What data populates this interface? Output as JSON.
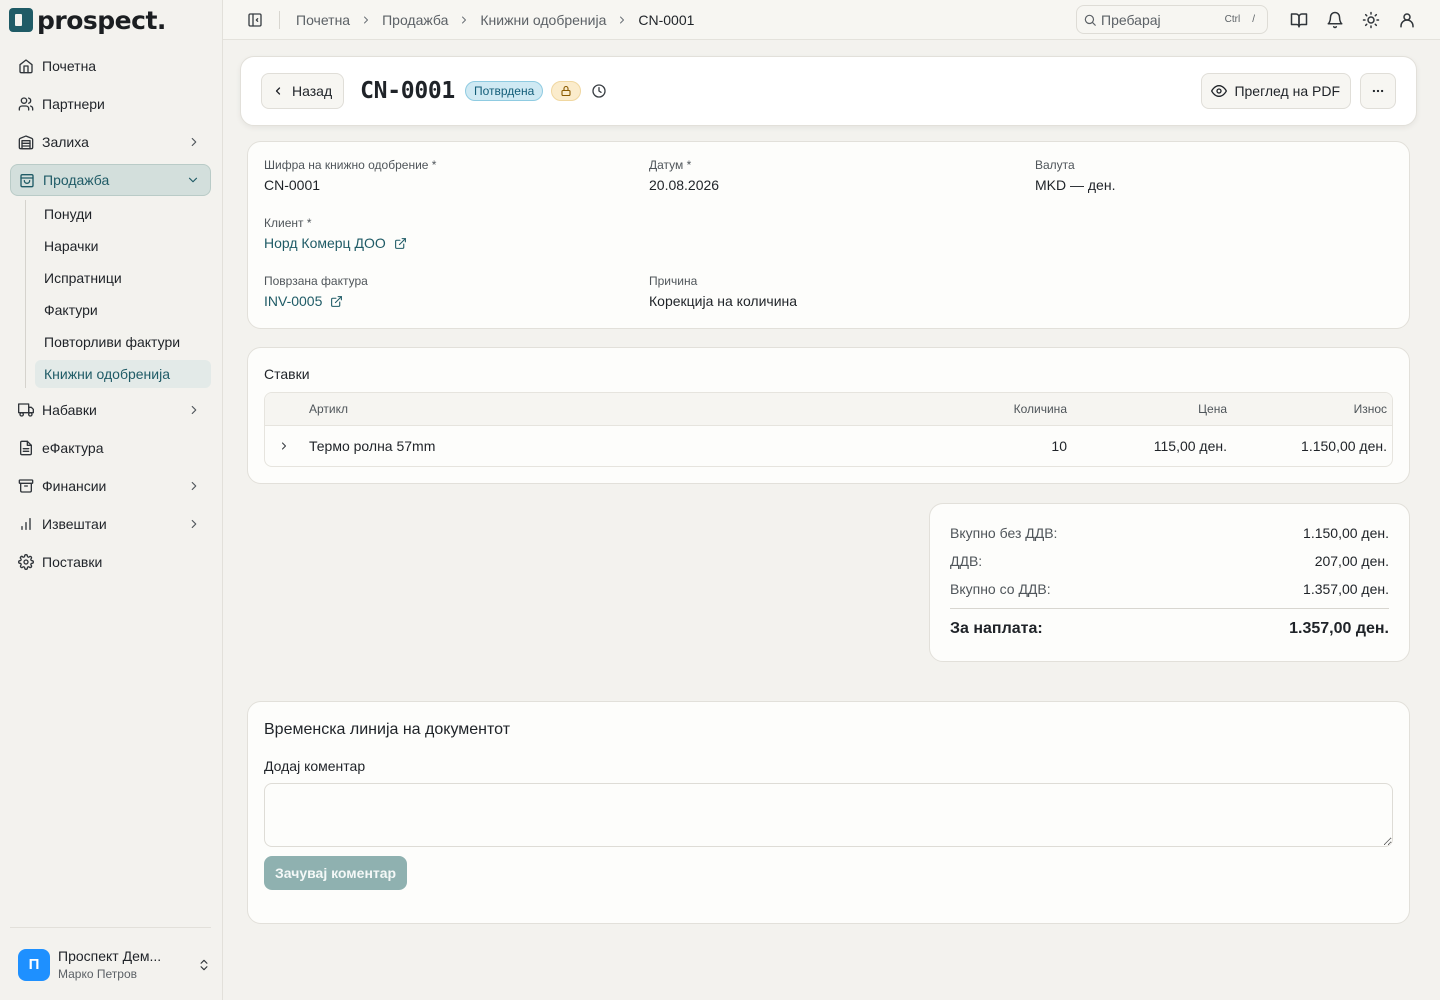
{
  "app": {
    "logo_text": "prospect.",
    "brand_color": "#1f5b66"
  },
  "sidebar": {
    "items": [
      {
        "label": "Почетна",
        "icon": "home-icon"
      },
      {
        "label": "Партнери",
        "icon": "users-icon"
      },
      {
        "label": "Залиха",
        "icon": "warehouse-icon"
      },
      {
        "label": "Продажба",
        "icon": "shopping-bag-icon"
      },
      {
        "label": "Набавки",
        "icon": "truck-icon"
      },
      {
        "label": "еФактура",
        "icon": "document-icon"
      },
      {
        "label": "Финансии",
        "icon": "archive-icon"
      },
      {
        "label": "Извештаи",
        "icon": "bar-chart-icon"
      },
      {
        "label": "Поставки",
        "icon": "gear-icon"
      }
    ],
    "sales_sub": [
      "Понуди",
      "Нарачки",
      "Испратници",
      "Фактури",
      "Повторливи фактури",
      "Книжни одобренија"
    ],
    "footer": {
      "avatar_letter": "П",
      "company": "Проспект Дем...",
      "user": "Марко Петров"
    }
  },
  "topbar": {
    "breadcrumb": [
      "Почетна",
      "Продажба",
      "Книжни одобренија",
      "CN-0001"
    ],
    "search_placeholder": "Пребарај",
    "kbd_ctrl": "Ctrl",
    "kbd_key": "/"
  },
  "header": {
    "back_label": "Назад",
    "doc_title": "CN-0001",
    "status": "Потврдена",
    "pdf_label": "Преглед на PDF"
  },
  "info": {
    "code_label": "Шифра на книжно одобрение *",
    "code_value": "CN-0001",
    "date_label": "Датум *",
    "date_value": "20.08.2026",
    "currency_label": "Валута",
    "currency_value": "MKD — ден.",
    "client_label": "Клиент *",
    "client_value": "Норд Комерц ДОО",
    "invoice_label": "Поврзана фактура",
    "invoice_value": "INV-0005",
    "reason_label": "Причина",
    "reason_value": "Корекција на количина"
  },
  "items": {
    "title": "Ставки",
    "columns": {
      "article": "Артикл",
      "qty": "Количина",
      "price": "Цена",
      "amount": "Износ"
    },
    "rows": [
      {
        "article": "Термо ролна 57mm",
        "qty": "10",
        "price": "115,00 ден.",
        "amount": "1.150,00 ден."
      }
    ]
  },
  "totals": {
    "net_label": "Вкупно без ДДВ:",
    "net_value": "1.150,00 ден.",
    "vat_label": "ДДВ:",
    "vat_value": "207,00 ден.",
    "gross_label": "Вкупно со ДДВ:",
    "gross_value": "1.357,00 ден.",
    "due_label": "За наплата:",
    "due_value": "1.357,00 ден."
  },
  "timeline": {
    "title": "Временска линија на документот",
    "comment_label": "Додај коментар",
    "comment_value": "",
    "save_label": "Зачувај коментар"
  }
}
